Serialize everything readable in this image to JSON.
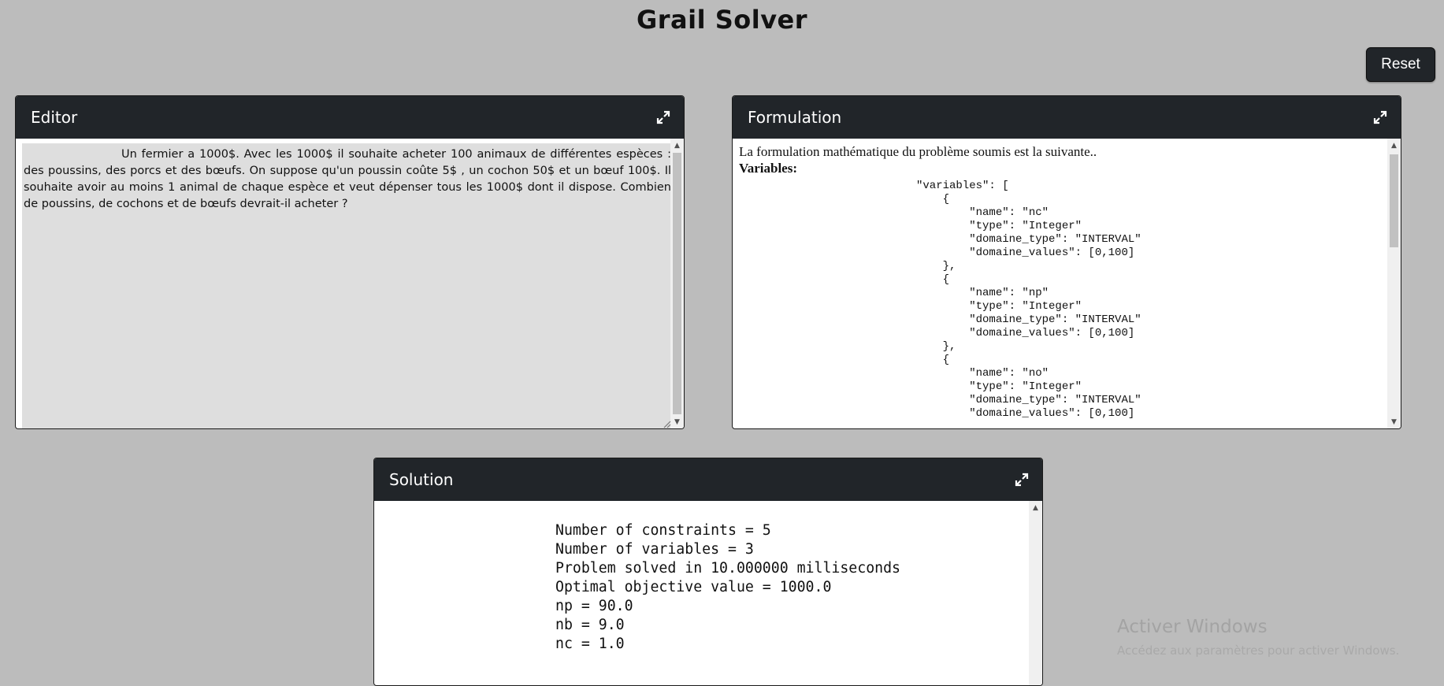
{
  "app": {
    "title": "Grail Solver"
  },
  "toolbar": {
    "reset_label": "Reset"
  },
  "editor": {
    "title": "Editor",
    "text": "Un fermier a 1000$. Avec les 1000$ il souhaite acheter 100 animaux de différentes espèces : des poussins, des porcs et des bœufs. On suppose qu'un poussin coûte 5$ , un cochon 50$  et un bœuf 100$. Il souhaite avoir au moins 1 animal de chaque espèce et veut dépenser tous les 1000$  dont il dispose. Combien de poussins, de cochons et de bœufs devrait-il acheter ?"
  },
  "formulation": {
    "title": "Formulation",
    "intro": "La formulation mathématique du problème soumis est la suivante..",
    "variables_label": "Variables:",
    "code": "\"variables\": [\n    {\n        \"name\": \"nc\"\n        \"type\": \"Integer\"\n        \"domaine_type\": \"INTERVAL\"\n        \"domaine_values\": [0,100]\n    },\n    {\n        \"name\": \"np\"\n        \"type\": \"Integer\"\n        \"domaine_type\": \"INTERVAL\"\n        \"domaine_values\": [0,100]\n    },\n    {\n        \"name\": \"no\"\n        \"type\": \"Integer\"\n        \"domaine_type\": \"INTERVAL\"\n        \"domaine_values\": [0,100]"
  },
  "solution": {
    "title": "Solution",
    "output": "Number of constraints = 5\nNumber of variables = 3\nProblem solved in 10.000000 milliseconds\nOptimal objective value = 1000.0\nnp = 90.0\nnb = 9.0\nnc = 1.0"
  },
  "watermark": {
    "title": "Activer Windows",
    "subtitle": "Accédez aux paramètres pour activer Windows."
  },
  "icons": {
    "expand": "expand-icon",
    "scroll_up": "scroll-up-arrow-icon",
    "scroll_down": "scroll-down-arrow-icon",
    "resize": "resize-grip-icon"
  },
  "colors": {
    "background": "#bcbcbc",
    "header": "#212529",
    "editor_bg": "#dedede"
  }
}
